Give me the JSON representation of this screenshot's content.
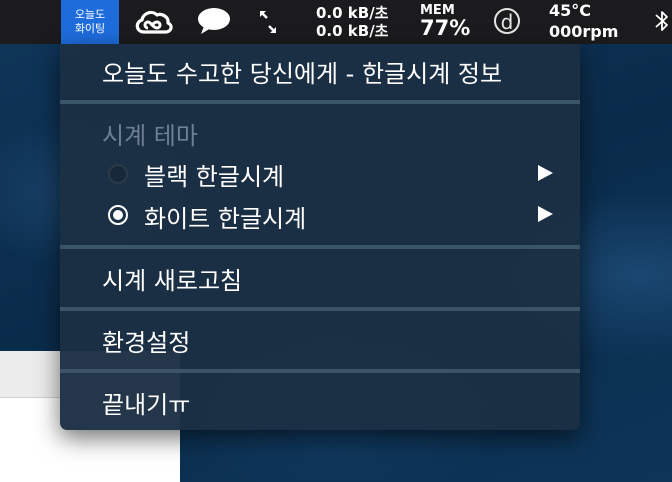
{
  "menubar": {
    "clock_label_line1": "오늘도",
    "clock_label_line2": "화이팅",
    "net_up": "0.0 kB/초",
    "net_down": "0.0 kB/초",
    "mem_label": "MEM",
    "mem_value": "77%",
    "d_glyph": "d",
    "temperature": "45°C",
    "fan": "000rpm",
    "icons": [
      "creative-cloud-icon",
      "chat-bubble-icon",
      "expand-arrows-icon",
      "d-circle-icon",
      "bluetooth-icon"
    ]
  },
  "menu": {
    "about": "오늘도 수고한 당신에게 - 한글시계 정보",
    "theme_header": "시계 테마",
    "themes": [
      {
        "label": "블랙 한글시계",
        "selected": false
      },
      {
        "label": "화이트 한글시계",
        "selected": true
      }
    ],
    "refresh": "시계 새로고침",
    "preferences": "환경설정",
    "quit": "끝내기ㅠ"
  },
  "colors": {
    "menubar_bg": "#1b1b1d",
    "clock_accent": "#1e6cdc",
    "menu_bg": "#1c3044",
    "separator": "#3c5468",
    "disabled_text": "#6d7f91"
  }
}
